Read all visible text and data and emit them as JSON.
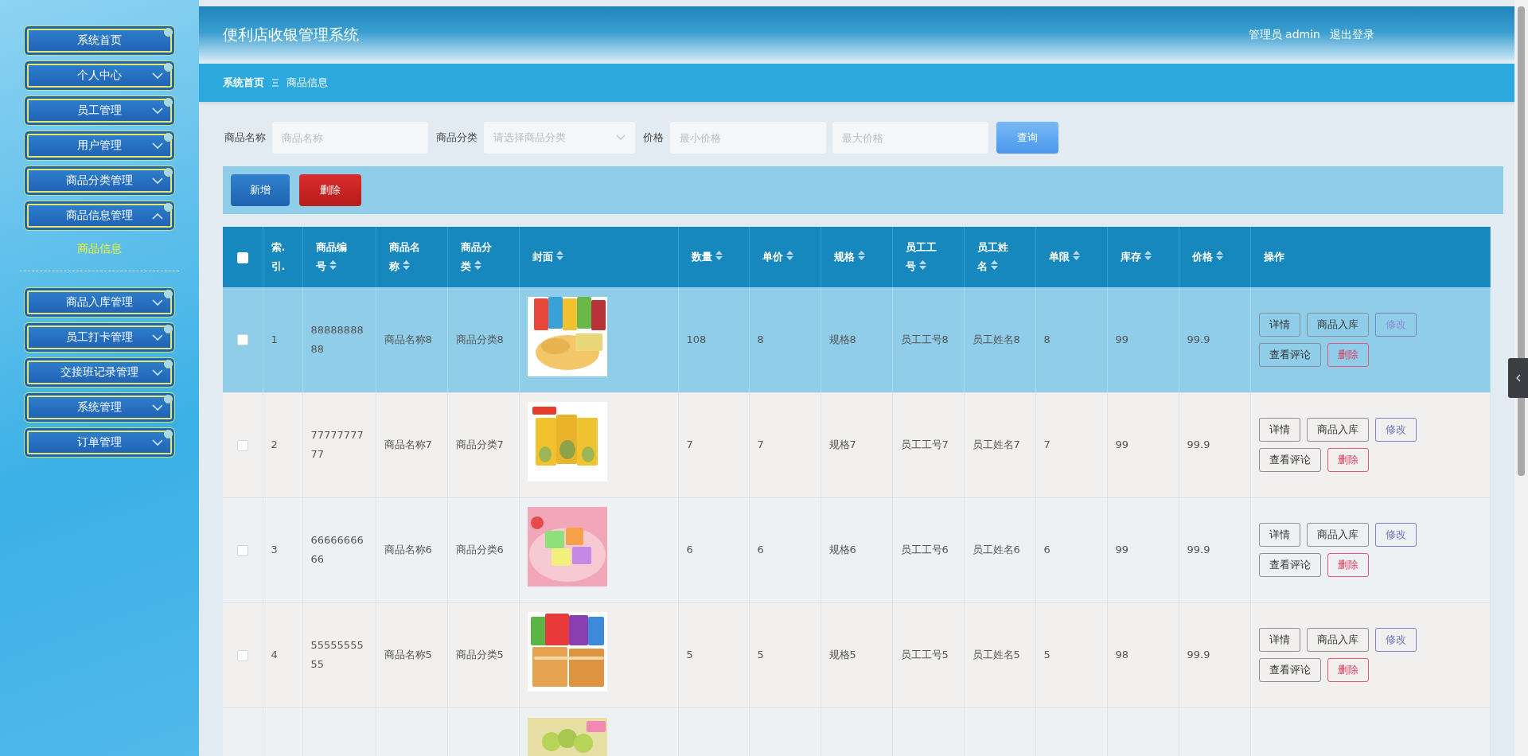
{
  "header": {
    "title": "便利店收银管理系统",
    "user_role": "管理员",
    "user_name": "admin",
    "logout": "退出登录"
  },
  "sidebar": {
    "items": [
      {
        "label": "系统首页",
        "kind": "link"
      },
      {
        "label": "个人中心",
        "kind": "menu",
        "expanded": false
      },
      {
        "label": "员工管理",
        "kind": "menu",
        "expanded": false
      },
      {
        "label": "用户管理",
        "kind": "menu",
        "expanded": false
      },
      {
        "label": "商品分类管理",
        "kind": "menu",
        "expanded": false
      },
      {
        "label": "商品信息管理",
        "kind": "menu",
        "expanded": true,
        "children": [
          {
            "label": "商品信息",
            "selected": true
          }
        ]
      },
      {
        "label": "商品入库管理",
        "kind": "menu",
        "expanded": false
      },
      {
        "label": "员工打卡管理",
        "kind": "menu",
        "expanded": false
      },
      {
        "label": "交接班记录管理",
        "kind": "menu",
        "expanded": false
      },
      {
        "label": "系统管理",
        "kind": "menu",
        "expanded": false
      },
      {
        "label": "订单管理",
        "kind": "menu",
        "expanded": false
      }
    ]
  },
  "breadcrumb": [
    {
      "label": "系统首页",
      "kind": "home"
    },
    {
      "label": "商品信息",
      "kind": "current"
    }
  ],
  "filters": [
    {
      "label": "商品名称",
      "kind": "input",
      "placeholder": "商品名称"
    },
    {
      "label": "商品分类",
      "kind": "select",
      "placeholder": "请选择商品分类"
    },
    {
      "label": "价格",
      "kind": "range",
      "placeholders": [
        "最小价格",
        "最大价格"
      ]
    }
  ],
  "search_button": "查询",
  "toolbar": [
    {
      "label": "新增",
      "kind": "primary"
    },
    {
      "label": "删除",
      "kind": "danger"
    }
  ],
  "table": {
    "columns": [
      {
        "kind": "checkbox",
        "checked": false
      },
      {
        "kind": "text",
        "label": "索.引.",
        "sortable": false
      },
      {
        "kind": "text",
        "label": "商品编号",
        "sortable": true
      },
      {
        "kind": "text",
        "label": "商品名称",
        "sortable": true
      },
      {
        "kind": "text",
        "label": "商品分类",
        "sortable": true
      },
      {
        "kind": "picture",
        "label": "封面",
        "sortable": true
      },
      {
        "kind": "text",
        "label": "数量",
        "sortable": true
      },
      {
        "kind": "text",
        "label": "单价",
        "sortable": true
      },
      {
        "kind": "text",
        "label": "规格",
        "sortable": true
      },
      {
        "kind": "text",
        "label": "员工工号",
        "sortable": true
      },
      {
        "kind": "text",
        "label": "员工姓名",
        "sortable": true
      },
      {
        "kind": "text",
        "label": "单限",
        "sortable": true
      },
      {
        "kind": "text",
        "label": "库存",
        "sortable": true
      },
      {
        "kind": "text",
        "label": "价格",
        "sortable": true
      },
      {
        "kind": "actions",
        "label": "操作",
        "sortable": false
      }
    ],
    "rows": [
      {
        "selected": true,
        "checked": false,
        "cells": [
          "1",
          "8888888888",
          "商品名称8",
          "商品分类8",
          "108",
          "8",
          "规格8",
          "员工工号8",
          "员工姓名8",
          "8",
          "99",
          "99.9"
        ],
        "actions": [
          {
            "label": "详情",
            "kind": "default"
          },
          {
            "label": "商品入库",
            "kind": "default"
          },
          {
            "label": "修改",
            "kind": "edit"
          },
          {
            "label": "查看评论",
            "kind": "default"
          },
          {
            "label": "删除",
            "kind": "danger"
          }
        ]
      },
      {
        "selected": false,
        "checked": false,
        "cells": [
          "2",
          "7777777777",
          "商品名称7",
          "商品分类7",
          "7",
          "7",
          "规格7",
          "员工工号7",
          "员工姓名7",
          "7",
          "99",
          "99.9"
        ],
        "actions": [
          {
            "label": "详情",
            "kind": "default"
          },
          {
            "label": "商品入库",
            "kind": "default"
          },
          {
            "label": "修改",
            "kind": "edit"
          },
          {
            "label": "查看评论",
            "kind": "default"
          },
          {
            "label": "删除",
            "kind": "danger"
          }
        ]
      },
      {
        "selected": false,
        "checked": false,
        "cells": [
          "3",
          "6666666666",
          "商品名称6",
          "商品分类6",
          "6",
          "6",
          "规格6",
          "员工工号6",
          "员工姓名6",
          "6",
          "99",
          "99.9"
        ],
        "actions": [
          {
            "label": "详情",
            "kind": "default"
          },
          {
            "label": "商品入库",
            "kind": "default"
          },
          {
            "label": "修改",
            "kind": "edit"
          },
          {
            "label": "查看评论",
            "kind": "default"
          },
          {
            "label": "删除",
            "kind": "danger"
          }
        ]
      },
      {
        "selected": false,
        "checked": false,
        "cells": [
          "4",
          "5555555555",
          "商品名称5",
          "商品分类5",
          "5",
          "5",
          "规格5",
          "员工工号5",
          "员工姓名5",
          "5",
          "98",
          "99.9"
        ],
        "actions": [
          {
            "label": "详情",
            "kind": "default"
          },
          {
            "label": "商品入库",
            "kind": "default"
          },
          {
            "label": "修改",
            "kind": "edit"
          },
          {
            "label": "查看评论",
            "kind": "default"
          },
          {
            "label": "删除",
            "kind": "danger"
          }
        ]
      },
      {
        "selected": false
      }
    ]
  }
}
